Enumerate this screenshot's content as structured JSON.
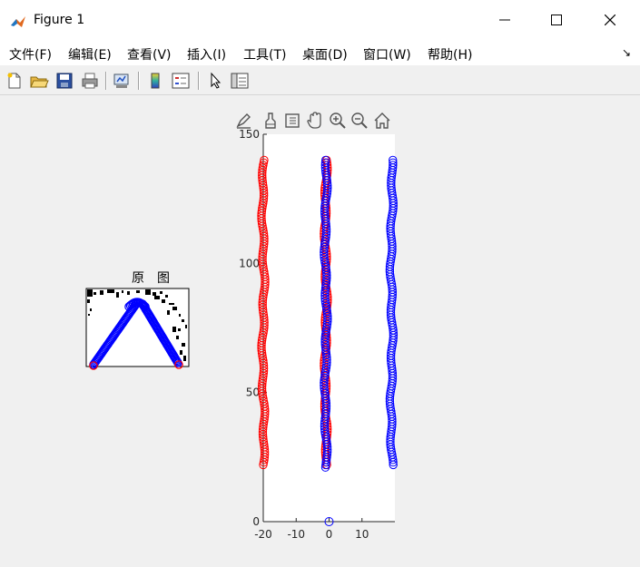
{
  "window": {
    "title": "Figure 1",
    "minimize_glyph": "─",
    "maximize_glyph": "☐",
    "close_glyph": "✕"
  },
  "menu": {
    "items": [
      "文件(F)",
      "编辑(E)",
      "查看(V)",
      "插入(I)",
      "工具(T)",
      "桌面(D)",
      "窗口(W)",
      "帮助(H)"
    ],
    "overflow_glyph": "↘"
  },
  "toolbar": {
    "buttons": [
      "new-figure-icon",
      "open-file-icon",
      "save-icon",
      "print-icon",
      "link-plot-icon",
      "insert-colorbar-icon",
      "insert-legend-icon",
      "edit-plot-icon",
      "property-inspector-icon"
    ]
  },
  "axes_toolbar": {
    "buttons": [
      "brush-icon",
      "data-tips-icon",
      "restore-view-icon",
      "pan-icon",
      "zoom-in-icon",
      "zoom-out-icon",
      "home-icon"
    ]
  },
  "chart_data": [
    {
      "type": "image",
      "title": "原　图",
      "description_markers": "blue circle markers tracing inverted-V, red circles at ends"
    },
    {
      "type": "scatter",
      "title": "",
      "xlabel": "",
      "ylabel": "",
      "xlim": [
        -20,
        20
      ],
      "ylim": [
        0,
        150
      ],
      "xticks": [
        -20,
        -10,
        0,
        10
      ],
      "yticks": [
        0,
        50,
        100,
        150
      ],
      "series": [
        {
          "color": "#ff0000",
          "marker": "circle",
          "x_center": -20,
          "y_from": 22,
          "y_to": 140
        },
        {
          "color": "#ff0000",
          "marker": "circle",
          "x_center": -1,
          "y_from": 22,
          "y_to": 140
        },
        {
          "color": "#0000ff",
          "marker": "circle",
          "x_center": -1,
          "y_from": 21,
          "y_to": 140
        },
        {
          "color": "#0000ff",
          "marker": "circle",
          "x_center": 19,
          "y_from": 22,
          "y_to": 140
        },
        {
          "color": "#0000ff",
          "marker": "circle",
          "points": [
            [
              0,
              0
            ]
          ]
        }
      ]
    }
  ]
}
